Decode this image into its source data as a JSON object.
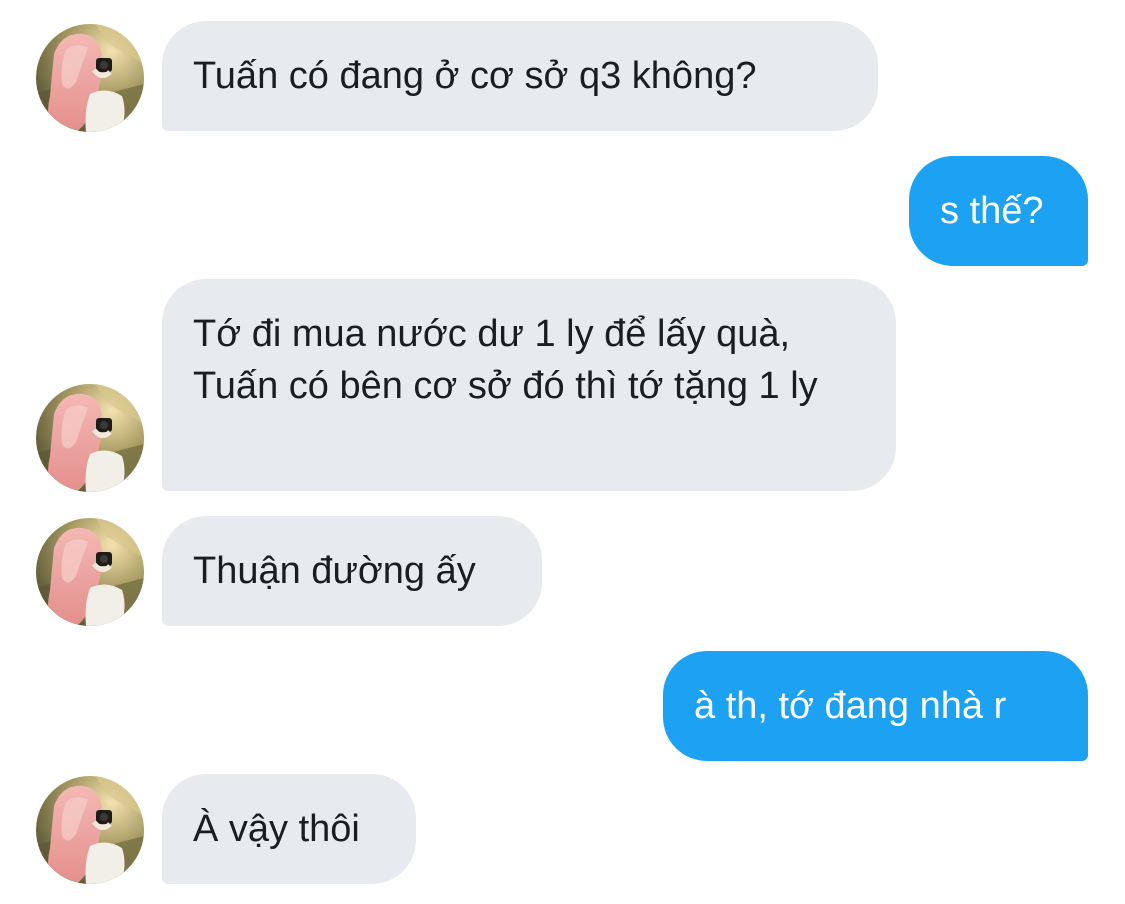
{
  "conversation": {
    "messages": [
      {
        "direction": "incoming",
        "text": "Tuấn có đang ở cơ sở q3 không?"
      },
      {
        "direction": "outgoing",
        "text": "s thế?"
      },
      {
        "direction": "incoming",
        "text": "Tớ đi mua nước dư 1 ly để lấy quà, Tuấn có bên cơ sở đó thì tớ tặng 1 ly"
      },
      {
        "direction": "incoming",
        "text": "Thuận đường ấy"
      },
      {
        "direction": "outgoing",
        "text": "à th, tớ đang nhà r"
      },
      {
        "direction": "incoming",
        "text": "À vậy thôi"
      }
    ]
  },
  "colors": {
    "incoming_bubble": "#e7ebef",
    "incoming_text": "#1a1d21",
    "outgoing_bubble": "#1da1f2",
    "outgoing_text": "#ffffff",
    "background": "#ffffff"
  },
  "icons": {
    "contact_avatar": "avatar-photo-pink-hair"
  }
}
